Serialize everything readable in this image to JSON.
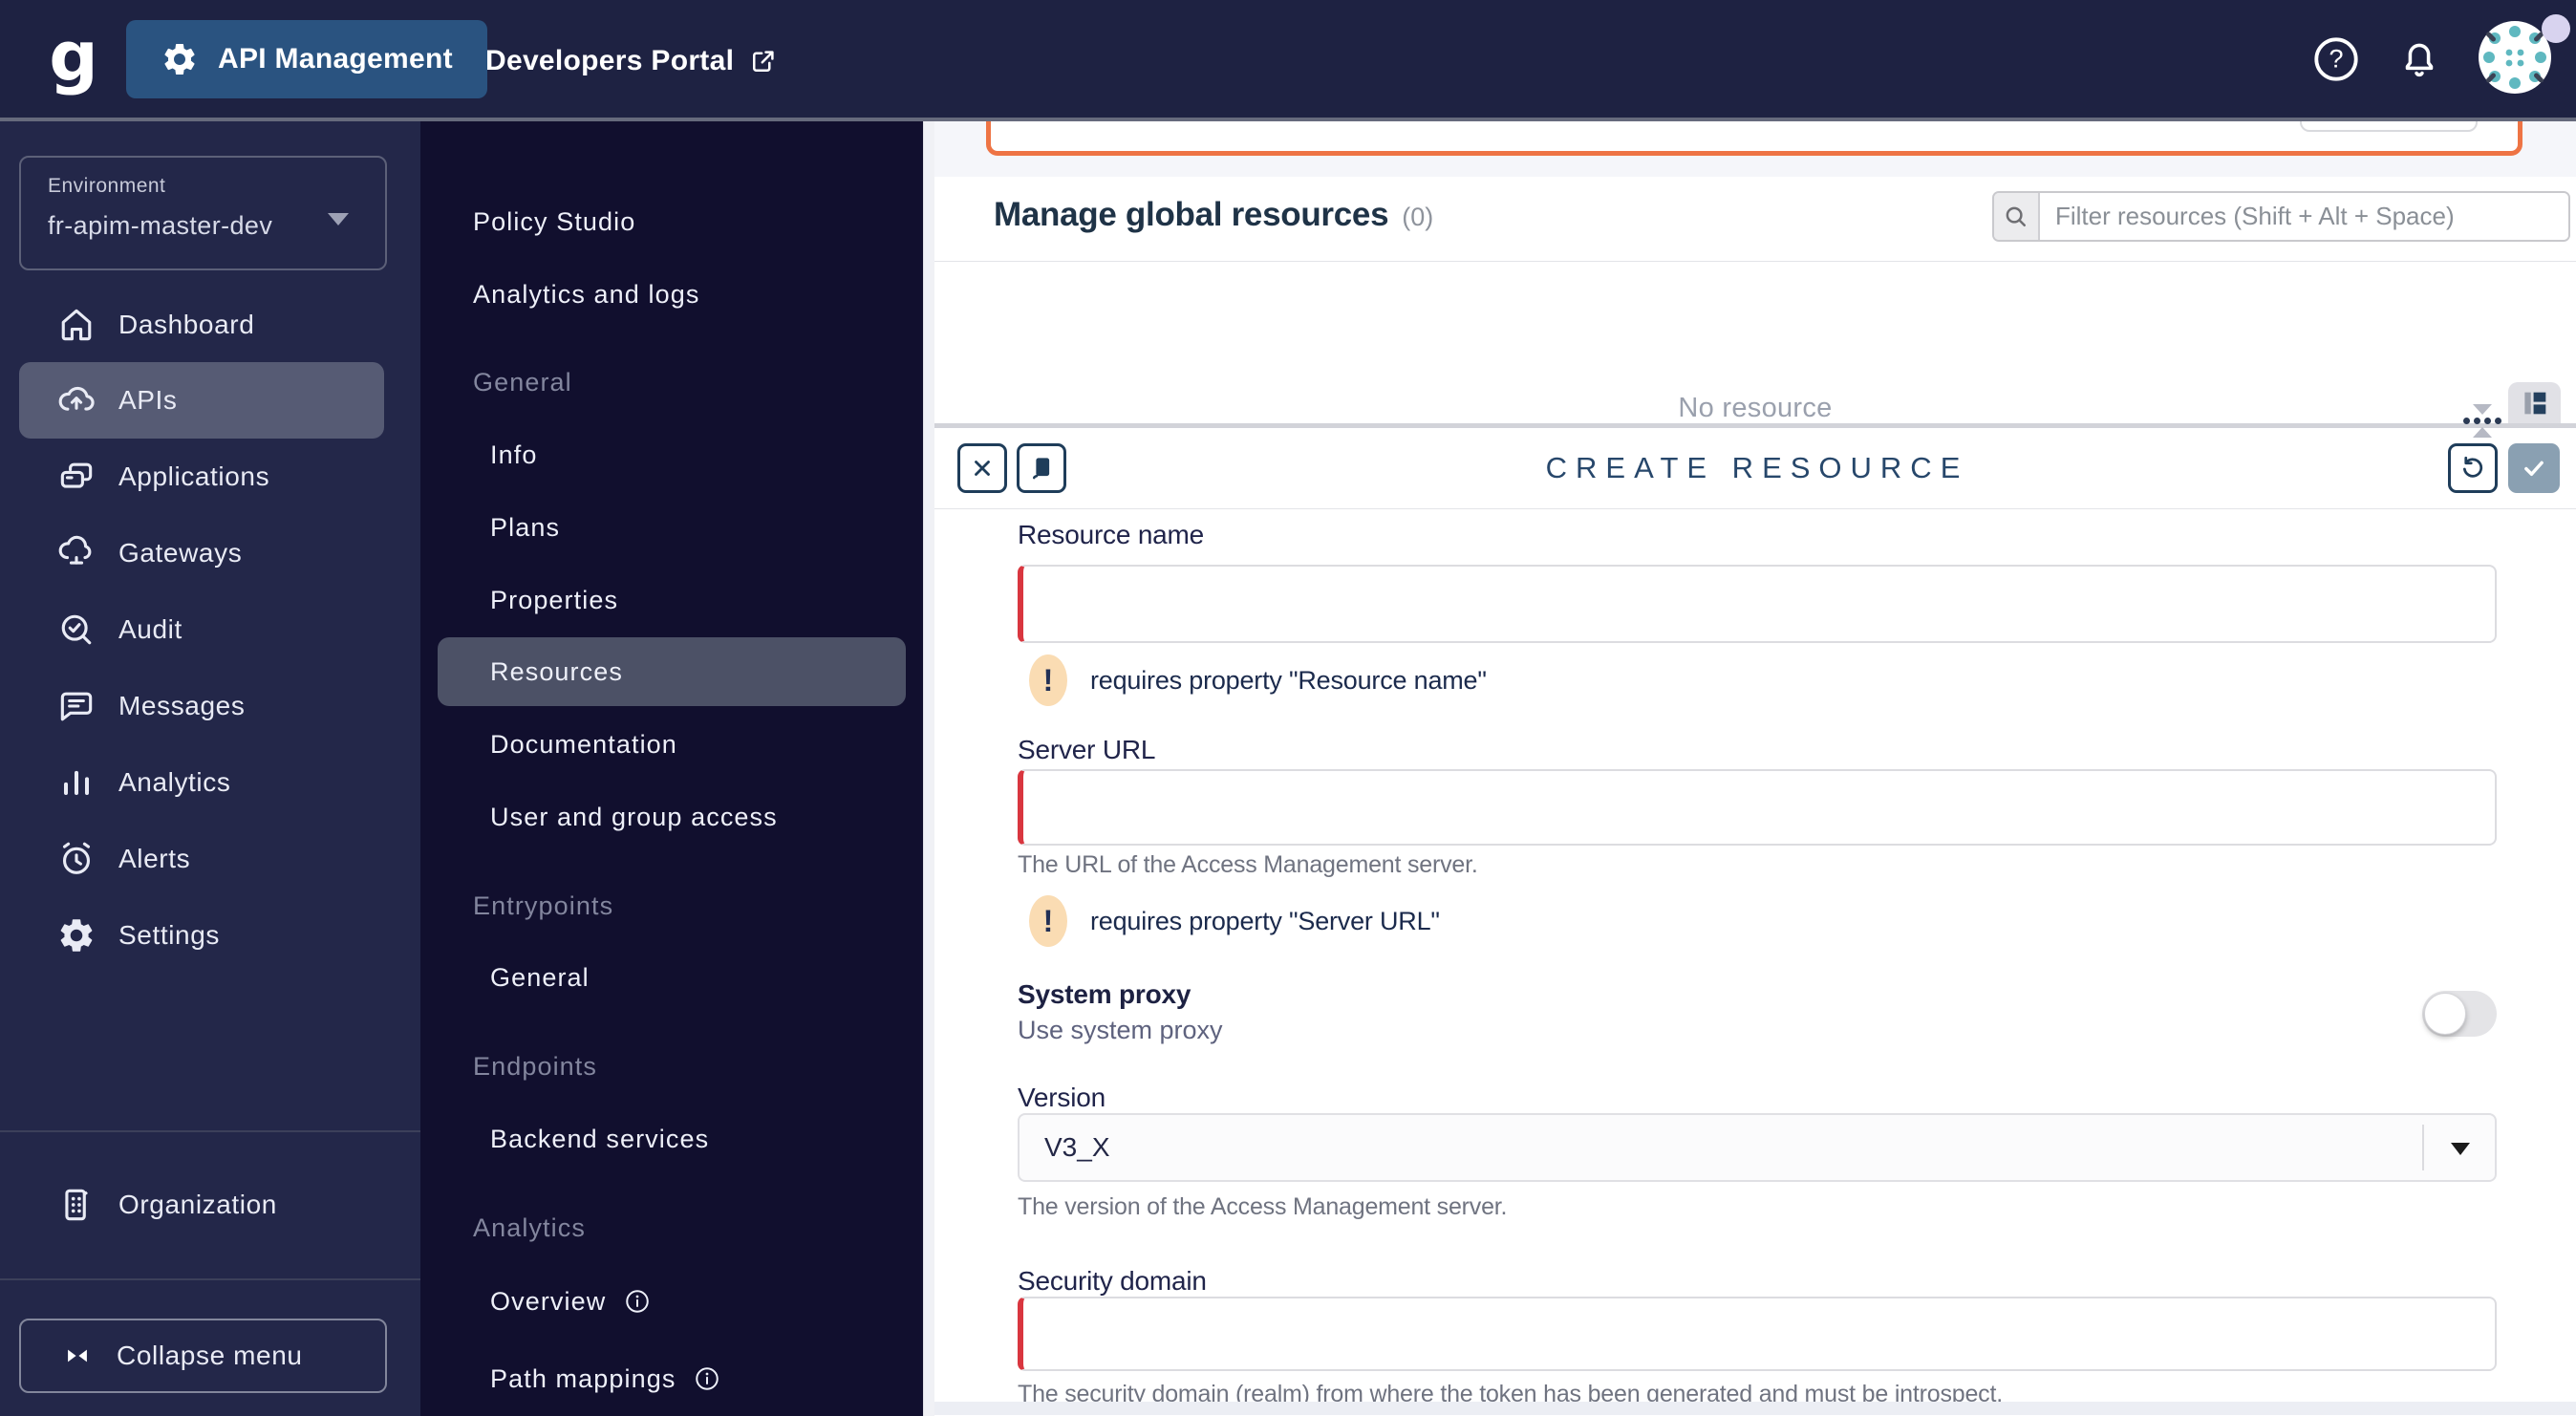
{
  "header": {
    "logo": "g",
    "app_name": "API Management",
    "portal": "Developers Portal"
  },
  "environment": {
    "label": "Environment",
    "value": "fr-apim-master-dev"
  },
  "sidebar": {
    "items": [
      {
        "label": "Dashboard"
      },
      {
        "label": "APIs"
      },
      {
        "label": "Applications"
      },
      {
        "label": "Gateways"
      },
      {
        "label": "Audit"
      },
      {
        "label": "Messages"
      },
      {
        "label": "Analytics"
      },
      {
        "label": "Alerts"
      },
      {
        "label": "Settings"
      }
    ],
    "organization_label": "Organization",
    "collapse_label": "Collapse menu"
  },
  "api_menu": {
    "top": [
      {
        "label": "Policy Studio"
      },
      {
        "label": "Analytics and logs"
      }
    ],
    "sections": [
      {
        "title": "General",
        "items": [
          {
            "label": "Info"
          },
          {
            "label": "Plans"
          },
          {
            "label": "Properties"
          },
          {
            "label": "Resources"
          },
          {
            "label": "Documentation"
          },
          {
            "label": "User and group access"
          }
        ]
      },
      {
        "title": "Entrypoints",
        "items": [
          {
            "label": "General"
          }
        ]
      },
      {
        "title": "Endpoints",
        "items": [
          {
            "label": "Backend services"
          }
        ]
      },
      {
        "title": "Analytics",
        "items": [
          {
            "label": "Overview"
          },
          {
            "label": "Path mappings"
          }
        ]
      }
    ]
  },
  "main": {
    "title": "Manage global resources",
    "count": "(0)",
    "filter_placeholder": "Filter resources (Shift + Alt + Space)",
    "empty_message": "No resource"
  },
  "panel": {
    "title": "CREATE RESOURCE",
    "warning_glyph": "!",
    "fields": {
      "resource_name": {
        "label": "Resource name",
        "error": "requires property \"Resource name\""
      },
      "server_url": {
        "label": "Server URL",
        "hint": "The URL of the Access Management server.",
        "error": "requires property \"Server URL\""
      },
      "system_proxy": {
        "label": "System proxy",
        "description": "Use system proxy"
      },
      "version": {
        "label": "Version",
        "value": "V3_X",
        "hint": "The version of the Access Management server."
      },
      "security_domain": {
        "label": "Security domain",
        "hint": "The security domain (realm) from where the token has been generated and must be introspect."
      }
    }
  },
  "colors": {
    "header_bg": "#1e2242",
    "sidebar_bg": "#232749",
    "submenu_bg": "#110f2e",
    "brand_blue": "#2a5380",
    "accent_orange": "#ee7444",
    "error_red": "#d9363f",
    "warning_bg": "#fadcb3",
    "dark_steel": "#1f3d5a",
    "check_button_bg": "#8aa0b2",
    "page_bg": "#f5f6fa",
    "avatar_teal": "#5fb8c0"
  }
}
